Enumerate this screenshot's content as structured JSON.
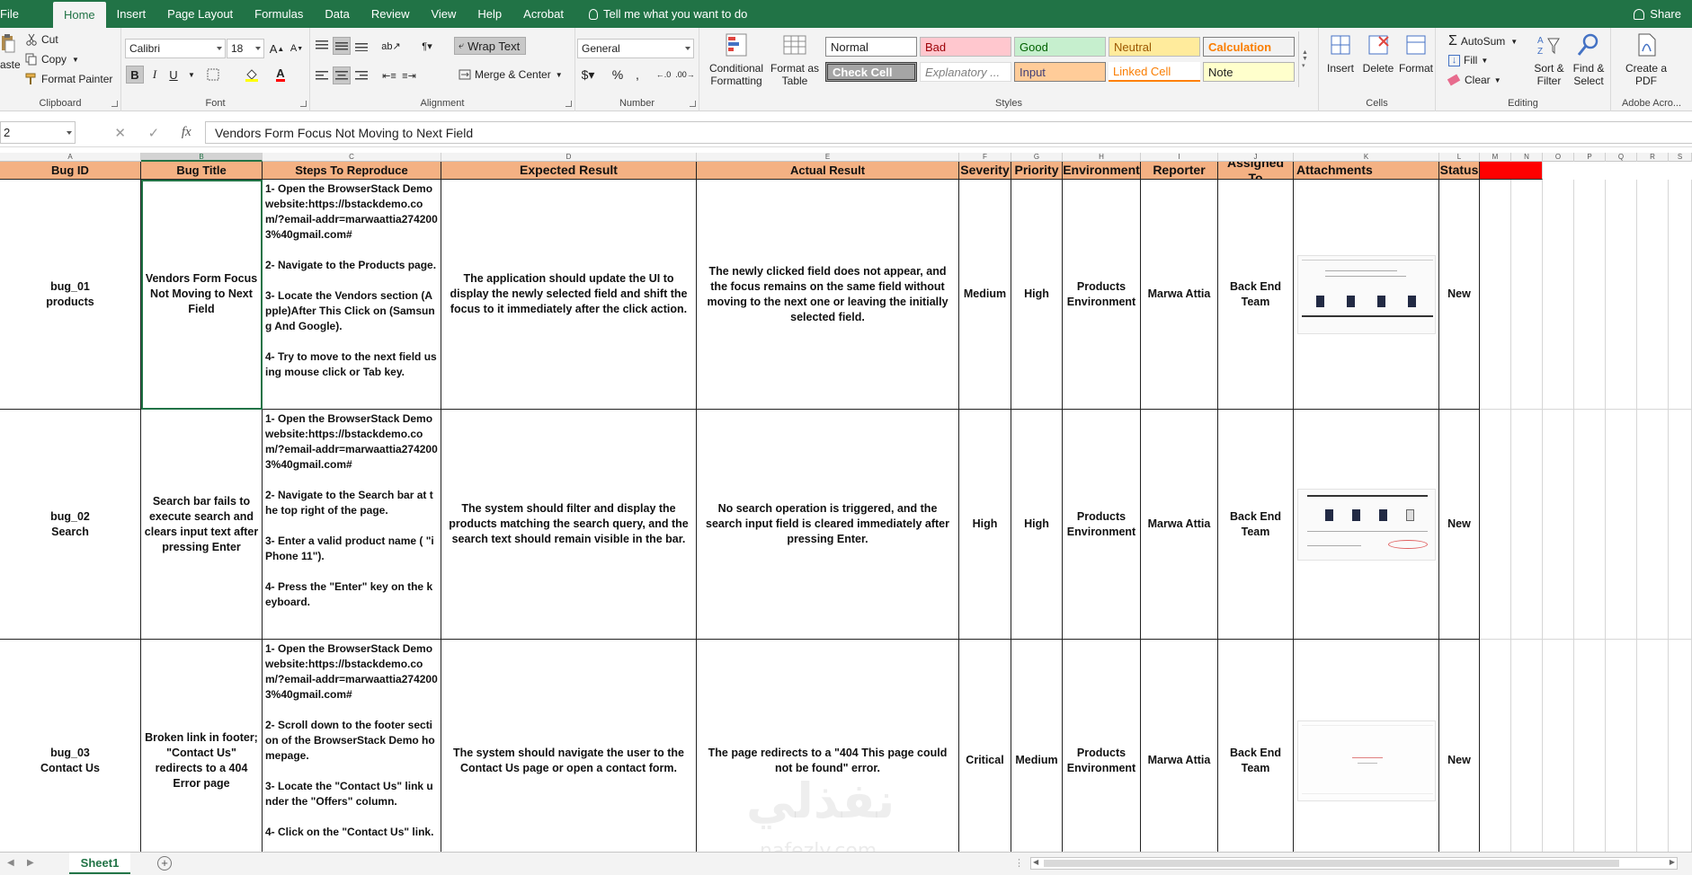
{
  "tabs": {
    "file": "File",
    "home": "Home",
    "insert": "Insert",
    "page_layout": "Page Layout",
    "formulas": "Formulas",
    "data": "Data",
    "review": "Review",
    "view": "View",
    "help": "Help",
    "acrobat": "Acrobat",
    "tell_me": "Tell me what you want to do",
    "share": "Share"
  },
  "ribbon": {
    "clipboard": {
      "paste": "aste",
      "cut": "Cut",
      "copy": "Copy",
      "format_painter": "Format Painter",
      "label": "Clipboard"
    },
    "font": {
      "name": "Calibri",
      "size": "18",
      "bold": "B",
      "italic": "I",
      "underline": "U",
      "label": "Font"
    },
    "alignment": {
      "wrap_text": "Wrap Text",
      "merge_center": "Merge & Center",
      "label": "Alignment"
    },
    "number": {
      "format": "General",
      "label": "Number"
    },
    "styles": {
      "conditional_formatting": "Conditional Formatting",
      "format_as_table": "Format as Table",
      "normal": "Normal",
      "bad": "Bad",
      "good": "Good",
      "neutral": "Neutral",
      "calculation": "Calculation",
      "check_cell": "Check Cell",
      "explanatory": "Explanatory ...",
      "input": "Input",
      "linked_cell": "Linked Cell",
      "note": "Note",
      "label": "Styles"
    },
    "cells": {
      "insert": "Insert",
      "delete": "Delete",
      "format": "Format",
      "label": "Cells"
    },
    "editing": {
      "autosum": "AutoSum",
      "fill": "Fill",
      "clear": "Clear",
      "sort_filter": "Sort & Filter",
      "find_select": "Find & Select",
      "label": "Editing"
    },
    "acrobat": {
      "create_pdf": "Create a PDF",
      "label": "Adobe Acro..."
    }
  },
  "formula_bar": {
    "name_box": "2",
    "content": "Vendors Form Focus Not Moving to Next Field"
  },
  "columns": [
    "A",
    "B",
    "C",
    "D",
    "E",
    "F",
    "G",
    "H",
    "I",
    "J",
    "K",
    "L",
    "M",
    "N",
    "O",
    "P",
    "Q",
    "R",
    "S"
  ],
  "headers": {
    "bug_id": "Bug ID",
    "bug_title": "Bug Title",
    "steps": "Steps To Reproduce",
    "expected": "Expected Result",
    "actual": "Actual Result",
    "severity": "Severity",
    "priority": "Priority",
    "environment": "Environment",
    "reporter": "Reporter",
    "assigned": "Assigned To",
    "attachments": "Attachments",
    "status": "Status"
  },
  "rows": [
    {
      "bug_id": "bug_01\nproducts",
      "title": "Vendors Form Focus Not Moving to Next Field",
      "steps": "1- Open the BrowserStack Demo website:https://bstackdemo.com/?email-addr=marwaattia2742003%40gmail.com#\n\n2- Navigate to the Products page.\n\n3- Locate the Vendors section (Apple)After This Click on (Samsung And Google).\n\n4- Try to move to the next field using mouse click or Tab key.",
      "expected": "The application should update the UI to display the newly selected field and shift the focus to it immediately after the click action.",
      "actual": "The newly clicked field does not appear, and the focus remains on the same field without moving to the next one or leaving the initially selected field.",
      "severity": "Medium",
      "priority": "High",
      "environment": "Products Environment",
      "reporter": "Marwa Attia",
      "assigned": "Back End Team",
      "status": "New"
    },
    {
      "bug_id": "bug_02\nSearch",
      "title": "Search bar fails to execute search and clears input text after pressing Enter",
      "steps": "1- Open the BrowserStack Demo website:https://bstackdemo.com/?email-addr=marwaattia2742003%40gmail.com#\n\n2- Navigate to the Search bar at the top right of the page.\n\n3- Enter a valid product name ( \"iPhone 11\").\n\n4- Press the \"Enter\" key on the keyboard.",
      "expected": "The system should filter and display the products matching the search query, and the search text should remain visible in the bar.",
      "actual": "No search operation is triggered, and the search input field is cleared immediately after pressing Enter.",
      "severity": "High",
      "priority": "High",
      "environment": "Products Environment",
      "reporter": "Marwa Attia",
      "assigned": "Back End Team",
      "status": "New"
    },
    {
      "bug_id": "bug_03\nContact Us",
      "title": "Broken link in footer; \"Contact Us\" redirects to a 404 Error page",
      "steps": "1- Open the BrowserStack Demo website:https://bstackdemo.com/?email-addr=marwaattia2742003%40gmail.com#\n\n2- Scroll down to the footer section of the BrowserStack Demo homepage.\n\n3- Locate the \"Contact Us\" link under the \"Offers\" column.\n\n4- Click on the \"Contact Us\" link.",
      "expected": "The system should navigate the user to the Contact Us page or open a contact form.",
      "actual": "The page redirects to a \"404 This page could not be found\" error.",
      "severity": "Critical",
      "priority": "Medium",
      "environment": "Products Environment",
      "reporter": "Marwa Attia",
      "assigned": "Back End Team",
      "status": "New"
    }
  ],
  "sheet_tab": "Sheet1",
  "watermark": {
    "arabic": "نفذلي",
    "latin": "nafezly.com"
  },
  "colors": {
    "accent": "#217346",
    "header_fill": "#f4b183",
    "marker_fill": "#ff0000"
  }
}
